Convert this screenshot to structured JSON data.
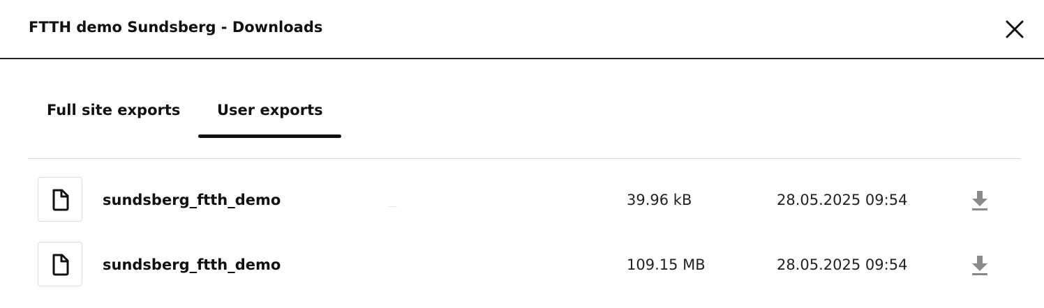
{
  "dialog": {
    "title": "FTTH demo Sundsberg - Downloads",
    "close_icon": "close-icon"
  },
  "tabs": [
    {
      "label": "Full site exports",
      "active": false
    },
    {
      "label": "User exports",
      "active": true
    }
  ],
  "files": [
    {
      "name": "sundsberg_ftth_demo",
      "size": "39.96 kB",
      "date": "28.05.2025 09:54",
      "file_icon": "file-icon",
      "download_icon": "download-icon"
    },
    {
      "name": "sundsberg_ftth_demo",
      "size": "109.15 MB",
      "date": "28.05.2025 09:54",
      "file_icon": "file-icon",
      "download_icon": "download-icon"
    }
  ],
  "colors": {
    "text": "#111111",
    "divider": "#d8d8d8",
    "icon_gray": "#8a8a8a"
  }
}
